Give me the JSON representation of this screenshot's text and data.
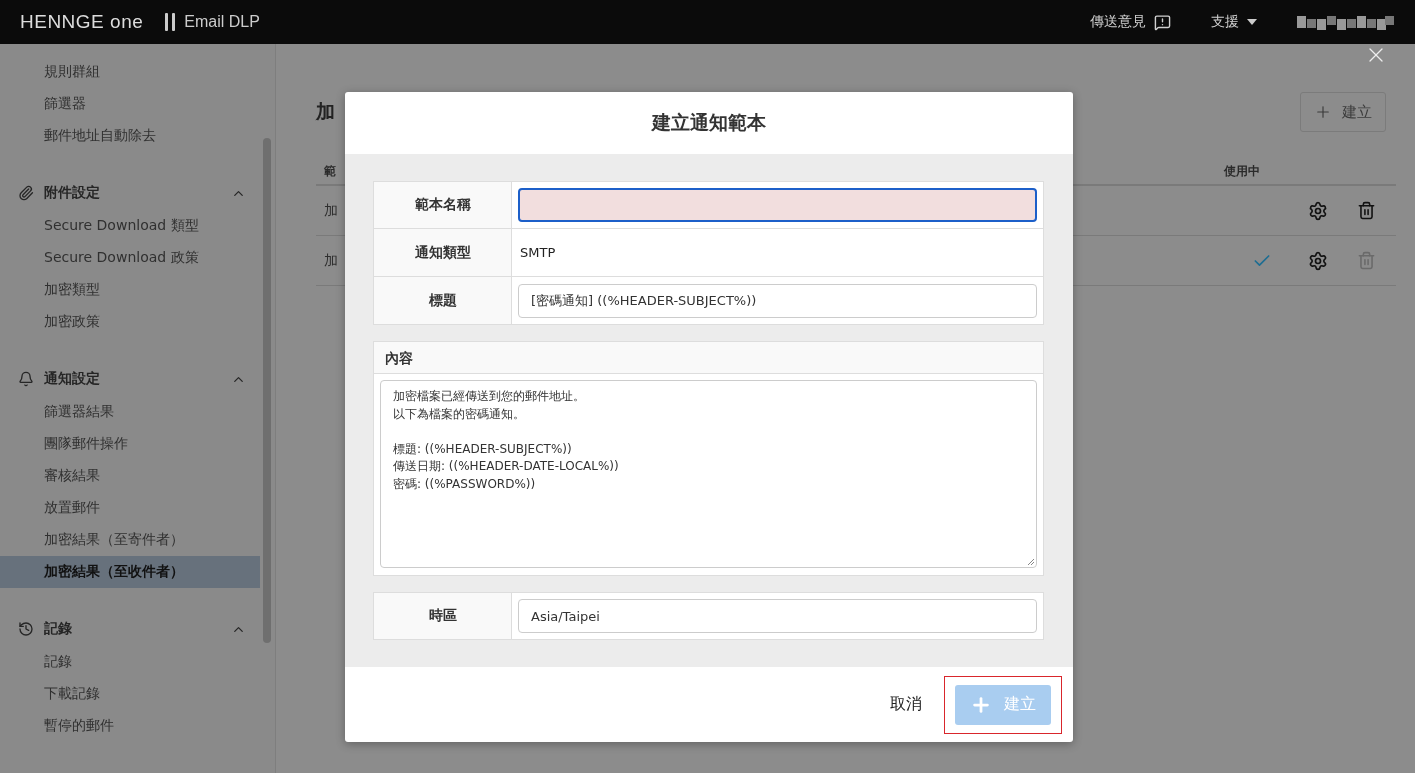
{
  "header": {
    "logo": "HENNGE one",
    "product": "Email DLP",
    "feedback": "傳送意見",
    "support": "支援"
  },
  "sidebar": {
    "groups": [
      {
        "items": [
          {
            "label": "規則群組",
            "selected": false
          },
          {
            "label": "篩選器",
            "selected": false
          },
          {
            "label": "郵件地址自動除去",
            "selected": false
          }
        ]
      },
      {
        "title": "附件設定",
        "expanded": true,
        "items": [
          {
            "label": "Secure Download 類型",
            "selected": false
          },
          {
            "label": "Secure Download 政策",
            "selected": false
          },
          {
            "label": "加密類型",
            "selected": false
          },
          {
            "label": "加密政策",
            "selected": false
          }
        ]
      },
      {
        "title": "通知設定",
        "expanded": true,
        "items": [
          {
            "label": "篩選器結果",
            "selected": false
          },
          {
            "label": "團隊郵件操作",
            "selected": false
          },
          {
            "label": "審核結果",
            "selected": false
          },
          {
            "label": "放置郵件",
            "selected": false
          },
          {
            "label": "加密結果（至寄件者）",
            "selected": false
          },
          {
            "label": "加密結果（至收件者）",
            "selected": true
          }
        ]
      },
      {
        "title": "記錄",
        "expanded": true,
        "items": [
          {
            "label": "記錄",
            "selected": false
          },
          {
            "label": "下載記錄",
            "selected": false
          },
          {
            "label": "暫停的郵件",
            "selected": false
          }
        ]
      }
    ]
  },
  "main": {
    "title": "加",
    "create_button": "建立",
    "columns": [
      "範",
      "使用中"
    ],
    "rows": [
      {
        "column_1": "加",
        "in_use": false,
        "delete_disabled": false
      },
      {
        "column_1": "加",
        "in_use": true,
        "delete_disabled": true
      }
    ]
  },
  "modal": {
    "title": "建立通知範本",
    "fields": [
      {
        "kind": "input",
        "label": "範本名稱",
        "invalid": true,
        "focused": true
      },
      {
        "kind": "static",
        "label": "通知類型",
        "value": "SMTP"
      },
      {
        "kind": "input",
        "label": "標題",
        "value": "[密碼通知] ((%HEADER-SUBJECT%))",
        "invalid": false,
        "focused": false
      },
      {
        "kind": "textarea",
        "label": "內容",
        "paragraphs": [
          [
            "加密檔案已經傳送到您的郵件地址。",
            "以下為檔案的密碼通知。"
          ],
          [
            "標題: ((%HEADER-SUBJECT%))",
            "傳送日期: ((%HEADER-DATE-LOCAL%))",
            "密碼: ((%PASSWORD%))"
          ]
        ]
      },
      {
        "kind": "input",
        "label": "時區",
        "value": "Asia/Taipei",
        "invalid": false,
        "focused": false
      }
    ],
    "cancel": "取消",
    "submit": {
      "label": "建立",
      "disabled": true,
      "highlighted": true
    }
  }
}
